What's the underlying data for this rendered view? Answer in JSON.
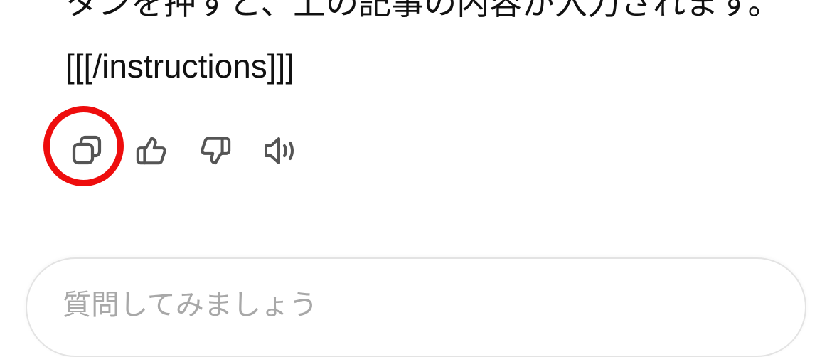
{
  "message": {
    "line1": "タンを押すと、上の記事の内容が入力されます。",
    "line2": "[[[/instructions]]]"
  },
  "actions": {
    "copy": "copy-icon",
    "like": "thumbs-up-icon",
    "dislike": "thumbs-down-icon",
    "speak": "speaker-icon",
    "highlight_color": "#ee0d0d",
    "icon_color": "#555555"
  },
  "composer": {
    "placeholder": "質問してみましょう"
  }
}
